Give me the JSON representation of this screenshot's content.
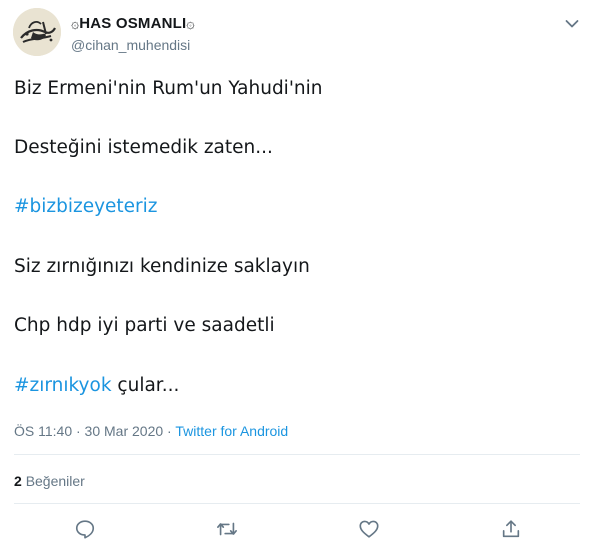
{
  "user": {
    "display_name": "HAS OSMANLI",
    "ornament_left": "۞",
    "ornament_right": "۞",
    "handle": "@cihan_muhendisi",
    "avatar_icon": "calligraphy-avatar",
    "menu_icon": "chevron-down-icon"
  },
  "tweet": {
    "lines": [
      {
        "text": "Biz Ermeni'nin Rum'un Yahudi'nin"
      },
      {
        "text": "Desteğini istemedik zaten..."
      },
      {
        "hashtag": "#bizbizeyeteriz"
      },
      {
        "text": "Siz zırnığınızı kendinize saklayın"
      },
      {
        "text": "Chp hdp iyi parti ve saadetli"
      },
      {
        "hashtag": "#zırnıkyok",
        "text": " çular..."
      }
    ]
  },
  "meta": {
    "timestamp": "ÖS 11:40 · 30 Mar 2020",
    "separator": " · ",
    "source": "Twitter for Android"
  },
  "stats": {
    "likes_count": "2",
    "likes_label": "Beğeniler"
  },
  "actions": {
    "reply_icon": "reply-icon",
    "retweet_icon": "retweet-icon",
    "like_icon": "heart-icon",
    "share_icon": "share-icon"
  },
  "colors": {
    "link": "#1b95e0",
    "secondary_text": "#657786",
    "divider": "#e6ecf0"
  }
}
